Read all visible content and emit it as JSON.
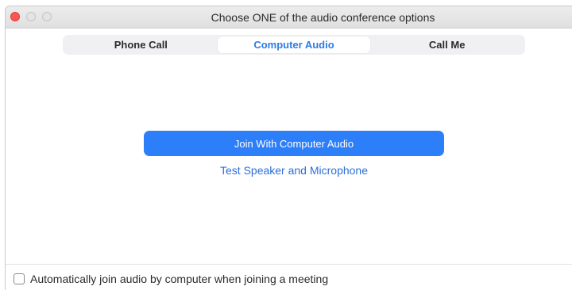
{
  "window": {
    "title": "Choose ONE of the audio conference options"
  },
  "tabs": [
    {
      "label": "Phone Call",
      "active": false
    },
    {
      "label": "Computer Audio",
      "active": true
    },
    {
      "label": "Call Me",
      "active": false
    }
  ],
  "main": {
    "join_button_label": "Join With Computer Audio",
    "test_link_label": "Test Speaker and Microphone"
  },
  "footer": {
    "auto_join_label": "Automatically join audio by computer when joining a meeting",
    "auto_join_checked": false
  },
  "colors": {
    "accent": "#2d7ff9",
    "close_button": "#fc5753"
  }
}
